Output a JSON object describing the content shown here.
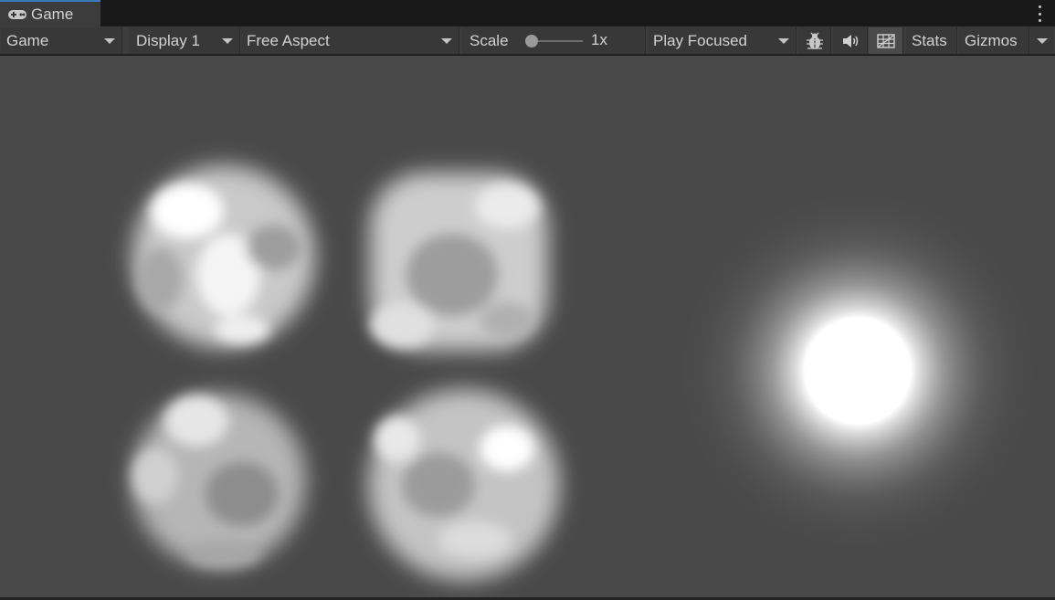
{
  "tab": {
    "label": "Game",
    "icon": "gamepad-icon"
  },
  "window_menu": {
    "icon": "kebab-menu-icon"
  },
  "toolbar": {
    "view_mode": "Game",
    "display": "Display 1",
    "aspect": "Free Aspect",
    "scale_label": "Scale",
    "scale_value": "1x",
    "scale_level": 0.0,
    "play_mode": "Play Focused",
    "debug_icon": "bug-icon",
    "audio_icon": "speaker-icon",
    "grid_icon": "grid-icon",
    "stats_label": "Stats",
    "gizmos_label": "Gizmos"
  },
  "viewport": {
    "background": "#494949",
    "sprites": [
      "smoke-puff-sprite",
      "smoke-puff-sprite",
      "smoke-puff-sprite",
      "smoke-puff-sprite",
      "glow-orb-sprite"
    ]
  },
  "colors": {
    "tab_accent": "#3a79bb",
    "toolbar_bg": "#3c3c3c",
    "viewport_bg": "#494949"
  }
}
